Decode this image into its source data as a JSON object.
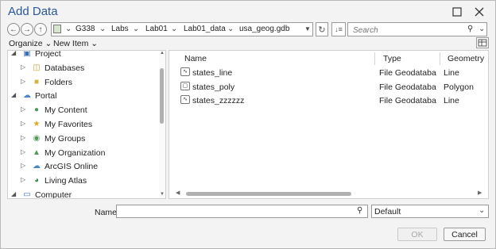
{
  "window": {
    "title": "Add Data",
    "minimize_icon": "minimize-icon",
    "close_icon": "close-icon"
  },
  "navbar": {
    "breadcrumbs": [
      "G338",
      "Labs",
      "Lab01",
      "Lab01_data",
      "usa_geog.gdb"
    ],
    "search_placeholder": "Search"
  },
  "toolbar": {
    "organize_label": "Organize",
    "new_item_label": "New Item"
  },
  "tree": {
    "items": [
      {
        "label": "Project",
        "icon": "project-icon",
        "level": 0,
        "expanded": true
      },
      {
        "label": "Databases",
        "icon": "database-icon",
        "level": 1,
        "expanded": false
      },
      {
        "label": "Folders",
        "icon": "folder-icon",
        "level": 1,
        "expanded": false
      },
      {
        "label": "Portal",
        "icon": "cloud-icon",
        "level": 0,
        "expanded": true
      },
      {
        "label": "My Content",
        "icon": "user-icon",
        "level": 1,
        "expanded": false
      },
      {
        "label": "My Favorites",
        "icon": "star-icon",
        "level": 1,
        "expanded": false
      },
      {
        "label": "My Groups",
        "icon": "group-icon",
        "level": 1,
        "expanded": false
      },
      {
        "label": "My Organization",
        "icon": "organization-icon",
        "level": 1,
        "expanded": false
      },
      {
        "label": "ArcGIS Online",
        "icon": "cloud-icon",
        "level": 1,
        "expanded": false
      },
      {
        "label": "Living Atlas",
        "icon": "globe-icon",
        "level": 1,
        "expanded": false
      },
      {
        "label": "Computer",
        "icon": "computer-icon",
        "level": 0,
        "expanded": true
      }
    ]
  },
  "files": {
    "columns": [
      "Name",
      "Type",
      "Geometry"
    ],
    "rows": [
      {
        "name": "states_line",
        "type": "File Geodatabase F",
        "geometry": "Line",
        "icon": "line-feature-icon"
      },
      {
        "name": "states_poly",
        "type": "File Geodatabase F",
        "geometry": "Polygon",
        "icon": "polygon-feature-icon"
      },
      {
        "name": "states_zzzzzz",
        "type": "File Geodatabase F",
        "geometry": "Line",
        "icon": "line-feature-icon"
      }
    ]
  },
  "footer": {
    "name_label": "Name",
    "name_value": "",
    "filter_value": "Default",
    "ok_label": "OK",
    "cancel_label": "Cancel"
  }
}
